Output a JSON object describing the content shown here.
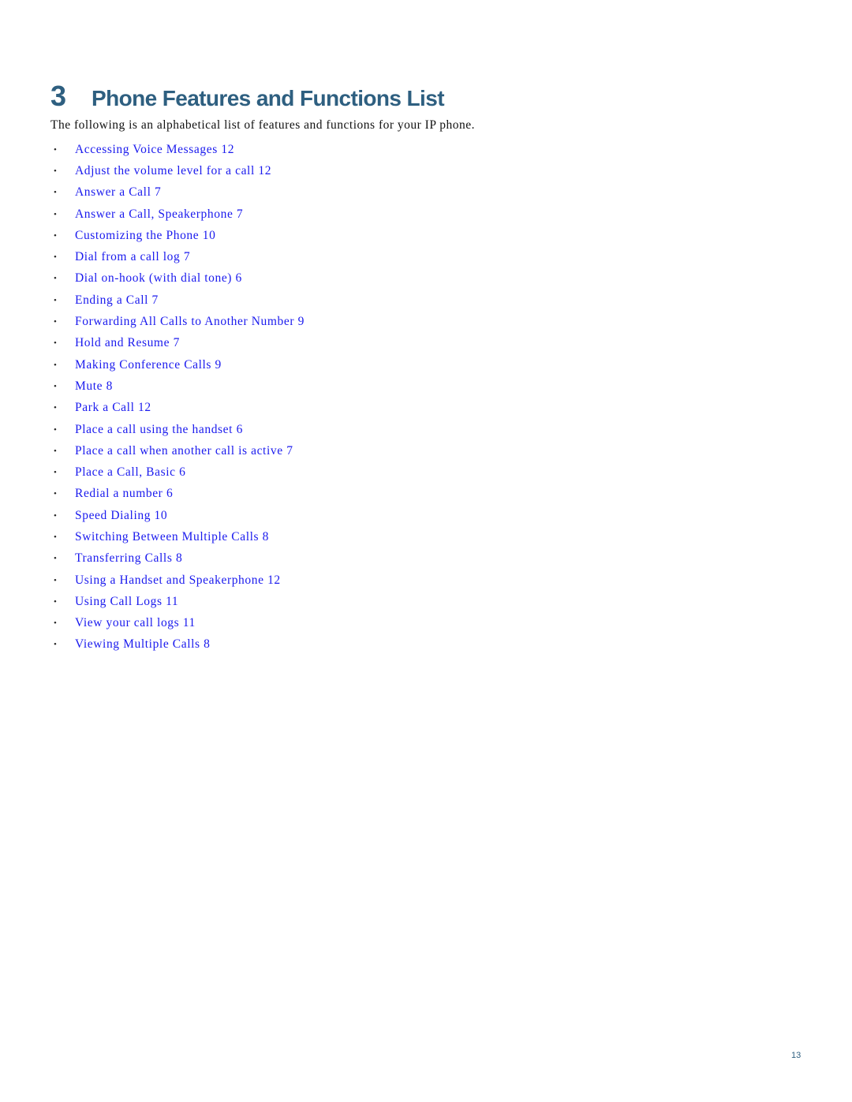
{
  "chapter": {
    "number": "3",
    "title": "Phone Features and Functions List"
  },
  "intro_text": "The following is an alphabetical list of features and functions for your IP phone.",
  "bullet_glyph": "•",
  "features": [
    {
      "label": "Accessing Voice Messages",
      "page": "12"
    },
    {
      "label": "Adjust the volume level for a call",
      "page": "12"
    },
    {
      "label": "Answer a Call",
      "page": "7"
    },
    {
      "label": "Answer a Call, Speakerphone",
      "page": "7"
    },
    {
      "label": "Customizing the Phone",
      "page": "10"
    },
    {
      "label": "Dial from a call log",
      "page": "7"
    },
    {
      "label": "Dial on-hook (with dial tone)",
      "page": "6"
    },
    {
      "label": "Ending a Call",
      "page": "7"
    },
    {
      "label": "Forwarding All Calls to Another Number",
      "page": "9"
    },
    {
      "label": "Hold and Resume",
      "page": "7"
    },
    {
      "label": "Making Conference Calls",
      "page": "9"
    },
    {
      "label": "Mute",
      "page": "8"
    },
    {
      "label": "Park a Call",
      "page": "12"
    },
    {
      "label": "Place a call using the handset",
      "page": "6"
    },
    {
      "label": "Place a call when another call is active",
      "page": "7"
    },
    {
      "label": "Place a Call, Basic",
      "page": "6"
    },
    {
      "label": "Redial a number",
      "page": "6"
    },
    {
      "label": "Speed Dialing",
      "page": "10"
    },
    {
      "label": "Switching Between Multiple Calls",
      "page": "8"
    },
    {
      "label": "Transferring Calls",
      "page": "8"
    },
    {
      "label": "Using a Handset and Speakerphone",
      "page": "12"
    },
    {
      "label": "Using Call Logs",
      "page": "11"
    },
    {
      "label": "View your call logs",
      "page": "11"
    },
    {
      "label": "Viewing Multiple Calls",
      "page": "8"
    }
  ],
  "footer": {
    "page_number": "13"
  },
  "colors": {
    "heading": "#2e5f80",
    "link": "#1a1aee",
    "body_text": "#111111"
  }
}
